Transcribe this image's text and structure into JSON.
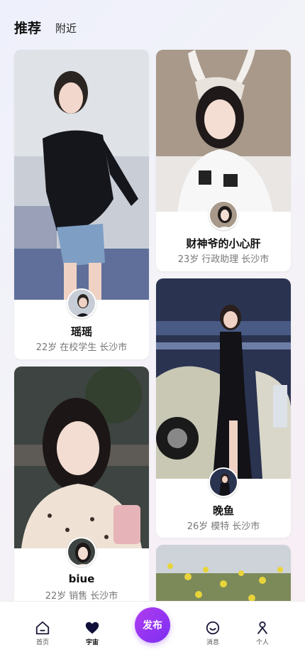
{
  "header": {
    "tabs": [
      {
        "label": "推荐",
        "active": true
      },
      {
        "label": "附近",
        "active": false
      }
    ]
  },
  "feed": {
    "cards": [
      {
        "name": "瑶瑶",
        "age": "22岁",
        "job": "在校学生",
        "city": "长沙市",
        "photo_desc": "woman in black top, denim shorts"
      },
      {
        "name": "财神爷的小心肝",
        "age": "23岁",
        "job": "行政助理",
        "city": "长沙市",
        "photo_desc": "woman with lace bunny ears"
      },
      {
        "name": "晚鱼",
        "age": "26岁",
        "job": "模特",
        "city": "长沙市",
        "photo_desc": "woman in black dress at car show"
      },
      {
        "name": "biue",
        "age": "22岁",
        "job": "销售",
        "city": "长沙市",
        "photo_desc": "woman with drink at night"
      },
      {
        "name": "",
        "age": "",
        "job": "",
        "city": "",
        "photo_desc": "yellow flowers field"
      }
    ]
  },
  "tabbar": {
    "home": "首页",
    "universe": "宇宙",
    "publish": "发布",
    "messages": "消息",
    "profile": "个人"
  },
  "colors": {
    "accent": "#8a36f0",
    "text_primary": "#111111",
    "text_secondary": "#777777"
  },
  "icons": [
    "home-icon",
    "heart-icon",
    "chat-icon",
    "person-icon"
  ]
}
